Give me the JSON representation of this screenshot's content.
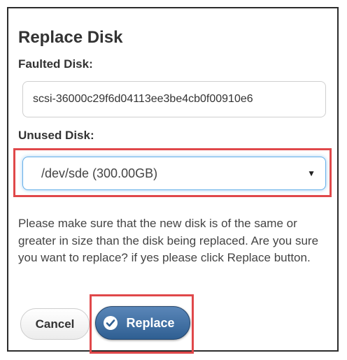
{
  "dialog": {
    "title": "Replace Disk",
    "faulted_label": "Faulted Disk:",
    "faulted_value": "scsi-36000c29f6d04113ee3be4cb0f00910e6",
    "unused_label": "Unused Disk:",
    "unused_selected": "/dev/sde (300.00GB)",
    "message": "Please make sure that the new disk is of the same or greater in size than the disk being replaced. Are you sure you want to replace? if yes please click Replace button."
  },
  "buttons": {
    "cancel_label": "Cancel",
    "replace_label": "Replace"
  },
  "icons": {
    "select_caret": "caret-down-icon",
    "replace_icon": "check-circle-icon"
  },
  "colors": {
    "highlight": "#e0484a",
    "primary_button": "#3a6a9e",
    "focus_ring": "#66afe9"
  }
}
